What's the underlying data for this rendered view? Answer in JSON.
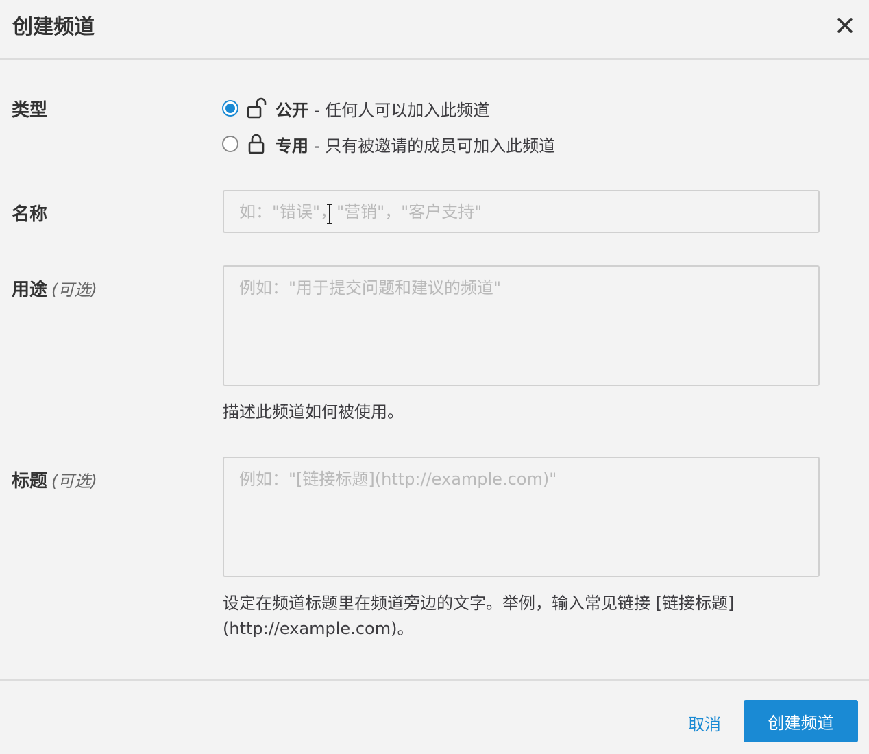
{
  "dialog": {
    "title": "创建频道",
    "close_icon": "close-icon"
  },
  "type_field": {
    "label": "类型",
    "options": [
      {
        "name": "公开",
        "description": "- 任何人可以加入此频道",
        "icon": "unlocked-lock-icon",
        "selected": true
      },
      {
        "name": "专用",
        "description": "- 只有被邀请的成员可加入此频道",
        "icon": "lock-icon",
        "selected": false
      }
    ]
  },
  "name_field": {
    "label": "名称",
    "value": "",
    "placeholder": "如：\"错误\"，\"营销\"，\"客户支持\""
  },
  "purpose_field": {
    "label": "用途",
    "optional": "(可选)",
    "value": "",
    "placeholder": "例如：\"用于提交问题和建议的频道\"",
    "help": "描述此频道如何被使用。"
  },
  "header_field": {
    "label": "标题",
    "optional": "(可选)",
    "value": "",
    "placeholder": "例如：\"[链接标题](http://example.com)\"",
    "help": "设定在频道标题里在频道旁边的文字。举例，输入常见链接 [链接标题](http://example.com)。"
  },
  "footer": {
    "cancel_label": "取消",
    "create_label": "创建频道"
  },
  "colors": {
    "accent": "#1a8ad4",
    "background": "#f3f3f3"
  }
}
